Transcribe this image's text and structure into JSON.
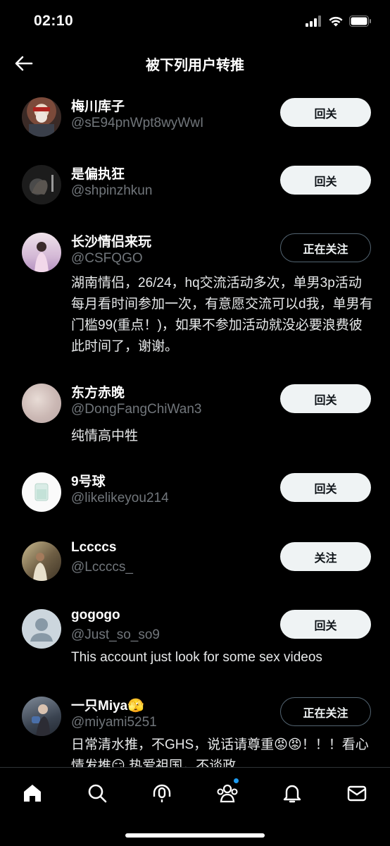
{
  "status": {
    "time": "02:10"
  },
  "header": {
    "title": "被下列用户转推"
  },
  "users": [
    {
      "name": "梅川库子",
      "handle": "@sE94pnWpt8wyWwI",
      "button": "回关",
      "bio": "",
      "avatar_color": "#6b4a3a"
    },
    {
      "name": "是偏执狂",
      "handle": "@shpinzhkun",
      "button": "回关",
      "bio": "",
      "avatar_color": "#2a2a2a"
    },
    {
      "name": "长沙情侣来玩",
      "handle": "@CSFQGO",
      "button": "正在关注",
      "bio": "湖南情侣，26/24，hq交流活动多次，单男3p活动每月看时间参加一次，有意愿交流可以d我，单男有门槛99(重点！)，如果不参加活动就没必要浪费彼此时间了，谢谢。",
      "avatar_color": "#c9b3c8"
    },
    {
      "name": "东方赤晚",
      "handle": "@DongFangChiWan3",
      "button": "回关",
      "bio": "纯情高中牲",
      "avatar_color": "#cdbdb8"
    },
    {
      "name": "9号球",
      "handle": "@likelikeyou214",
      "button": "回关",
      "bio": "",
      "avatar_color": "#f4f6f4"
    },
    {
      "name": "Lccccs",
      "handle": "@Lccccs_",
      "button": "关注",
      "bio": "",
      "avatar_color": "#8a7a5e"
    },
    {
      "name": "gogogo",
      "handle": "@Just_so_so9",
      "button": "回关",
      "bio": "This account just look for some sex videos",
      "avatar_color": "#ccd6dd"
    },
    {
      "name": "一只Miya🫣",
      "handle": "@miyami5251",
      "button": "正在关注",
      "bio": "日常清水推，不GHS，说话请尊重😡😡！！！看心情发推😏 热爱祖国，不谈政",
      "avatar_color": "#3f4a5a"
    }
  ],
  "colors": {
    "background": "#000000",
    "accent": "#1d9bf0",
    "muted": "#71767b",
    "button_light": "#eff3f4"
  },
  "tabs": [
    "home-icon",
    "search-icon",
    "spaces-icon",
    "communities-icon",
    "notifications-icon",
    "messages-icon"
  ]
}
